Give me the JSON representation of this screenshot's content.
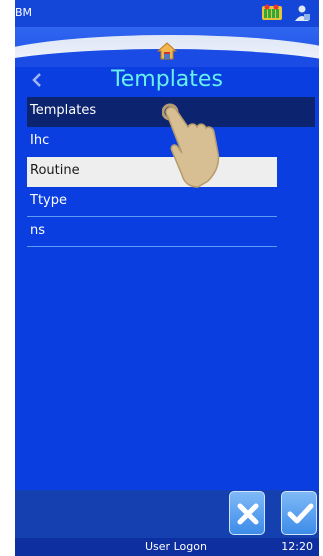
{
  "status_bar": {
    "title": "BM"
  },
  "header": {
    "title": "Templates"
  },
  "list": {
    "items": [
      {
        "label": "Templates"
      },
      {
        "label": "Ihc"
      },
      {
        "label": "Routine"
      },
      {
        "label": "Ttype"
      },
      {
        "label": "ns"
      }
    ]
  },
  "footer": {
    "user_label": "User Logon",
    "time": "12:20"
  },
  "icons": {
    "status_left": "battery-printer-icon",
    "status_right": "user-network-icon",
    "home": "home-icon",
    "back": "back-chevron-icon",
    "cancel": "close-icon",
    "ok": "check-icon",
    "pointer": "hand-pointer-icon"
  },
  "colors": {
    "background": "#0a3ee0",
    "title": "#67f0ee",
    "selected_row": "#0c236f",
    "highlight_row": "#eeeeee"
  }
}
